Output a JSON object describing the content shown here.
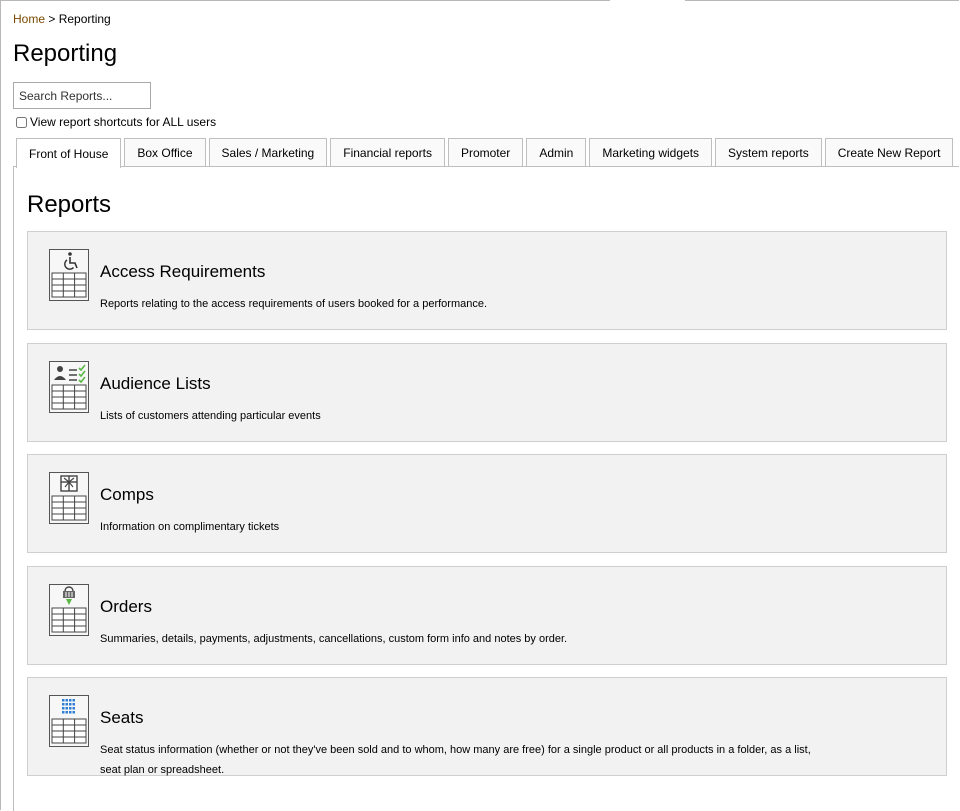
{
  "breadcrumb": {
    "home": "Home",
    "separator": " > ",
    "current": "Reporting"
  },
  "page_title": "Reporting",
  "search": {
    "placeholder": "Search Reports...",
    "value": ""
  },
  "shortcut_checkbox": {
    "label": "View report shortcuts for ALL users",
    "checked": false
  },
  "tabs": [
    {
      "label": "Front of House",
      "active": true
    },
    {
      "label": "Box Office"
    },
    {
      "label": "Sales / Marketing"
    },
    {
      "label": "Financial reports"
    },
    {
      "label": "Promoter"
    },
    {
      "label": "Admin"
    },
    {
      "label": "Marketing widgets"
    },
    {
      "label": "System reports"
    },
    {
      "label": "Create New Report"
    }
  ],
  "panel": {
    "heading": "Reports"
  },
  "reports": [
    {
      "title": "Access Requirements",
      "description": "Reports relating to the access requirements of users booked for a performance.",
      "icon": "wheelchair-table-icon"
    },
    {
      "title": "Audience Lists",
      "description": "Lists of customers attending particular events",
      "icon": "person-list-table-icon"
    },
    {
      "title": "Comps",
      "description": "Information on complimentary tickets",
      "icon": "gift-table-icon"
    },
    {
      "title": "Orders",
      "description": "Summaries, details, payments, adjustments, cancellations, custom form info and notes by order.",
      "icon": "basket-table-icon"
    },
    {
      "title": "Seats",
      "description": "Seat status information (whether or not they've been sold and to whom, how many are free) for a single product or all products in a folder, as a list, seat plan or spreadsheet.",
      "icon": "seat-grid-table-icon"
    }
  ],
  "colors": {
    "link": "#7a4a00",
    "card_bg": "#f2f2f2",
    "check_green": "#58b846",
    "seat_blue": "#2f7fd6"
  }
}
